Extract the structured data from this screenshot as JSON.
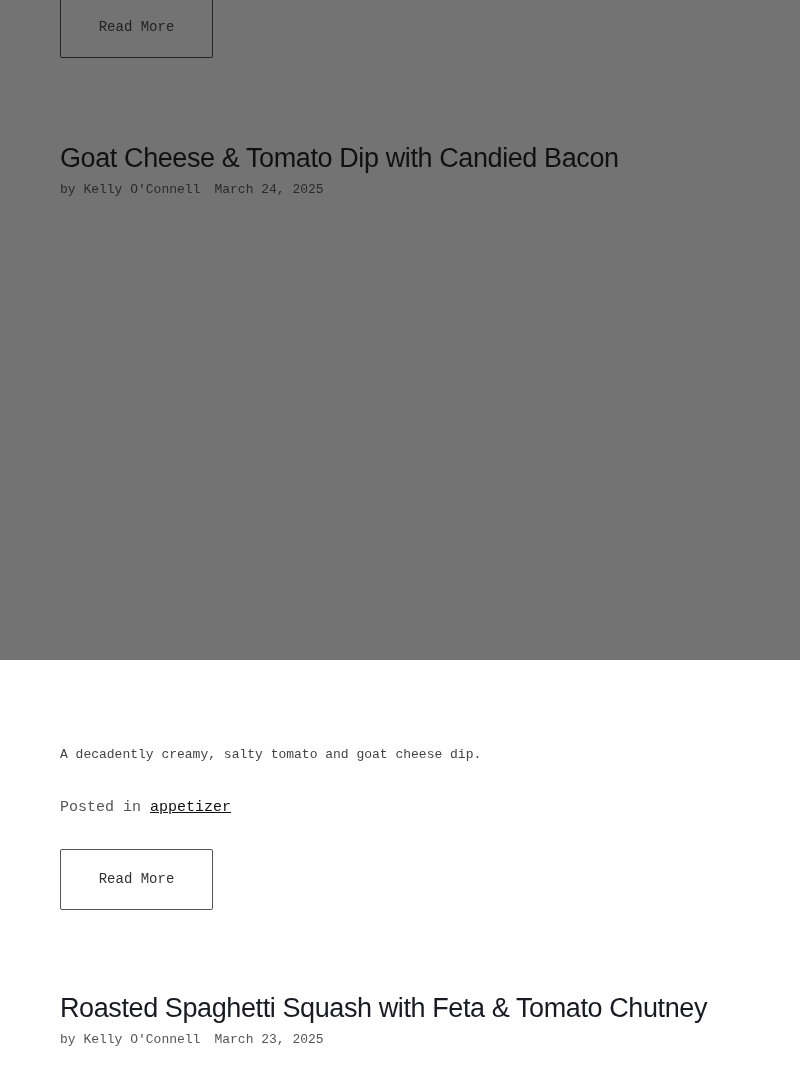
{
  "posts": [
    {
      "read_more": "Read More"
    },
    {
      "title": "Goat Cheese & Tomato Dip with Candied Bacon",
      "author": "by Kelly O'Connell",
      "date": "March 24, 2025",
      "excerpt": "A decadently creamy, salty tomato and goat cheese dip.",
      "posted_in": "Posted in",
      "category": "appetizer",
      "read_more": "Read More"
    },
    {
      "title": "Roasted Spaghetti Squash with Feta & Tomato Chutney",
      "author": "by Kelly O'Connell",
      "date": "March 23, 2025"
    }
  ]
}
